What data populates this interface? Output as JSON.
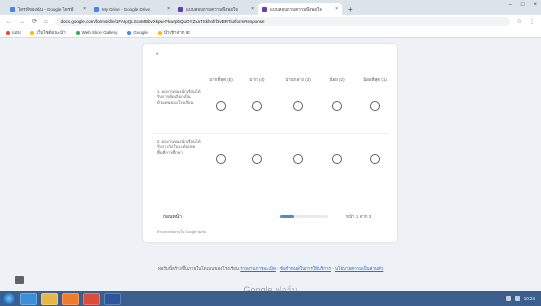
{
  "browser": {
    "tabs": [
      {
        "label": "ไดรฟ์ของฉัน - Google ไดรฟ์",
        "active": false
      },
      {
        "label": "My Drive - Google Drive",
        "active": false
      },
      {
        "label": "แบบสอบถามความพึงพอใจ",
        "active": false
      },
      {
        "label": "แบบสอบถามความพึงพอใจ",
        "active": true
      }
    ],
    "new_tab_label": "+",
    "window_controls": [
      "–",
      "□",
      "×"
    ],
    "nav": {
      "back": "←",
      "forward": "→",
      "reload": "⟳",
      "home": "⌂"
    },
    "url": "docs.google.com/forms/d/e/1FAIpQLScxMBbvXkpw-FkwrpbQuOYZxaTSkhnfrf3vBRTiu/formResponse",
    "bookmarks": [
      {
        "label": "แอป"
      },
      {
        "label": "เว็บไซต์แนะนำ"
      },
      {
        "label": "Web Slice Gallery"
      },
      {
        "label": "Google"
      },
      {
        "label": "นำเข้าจาก IE"
      }
    ]
  },
  "form": {
    "required_marker": "*",
    "columns": [
      "มากที่สุด (5)",
      "มาก (4)",
      "ปานกลาง (3)",
      "น้อย (2)",
      "น้อยที่สุด (1)"
    ],
    "rows": [
      {
        "label": "1. ผลงานของนักเรียนได้รับการคัดเลือกเป็นตัวแทนของโรงเรียน"
      },
      {
        "label": "2. ผลงานของนักเรียนได้รับรางวัลในระดับเขตพื้นที่การศึกษา"
      }
    ],
    "back_button": "ก่อนหน้า",
    "progress": 0.3,
    "page_count": "หน้า 1 จาก 3",
    "note": "ห้ามส่งรหัสผ่านใน Google ฟอร์ม"
  },
  "footer": {
    "text": "ฟอร์มนี้สร้างขึ้นภายในโดเมนของโรงเรียน",
    "link1": "รายงานการละเมิด",
    "link2": "ข้อกำหนดในการให้บริการ",
    "link3": "นโยบายความเป็นส่วนตัว",
    "brand_google": "Google",
    "brand_forms": "ฟอร์ม"
  },
  "taskbar": {
    "apps": [
      "internet-explorer",
      "file-explorer",
      "media-player",
      "chrome",
      "word"
    ],
    "clock": "10:24"
  }
}
